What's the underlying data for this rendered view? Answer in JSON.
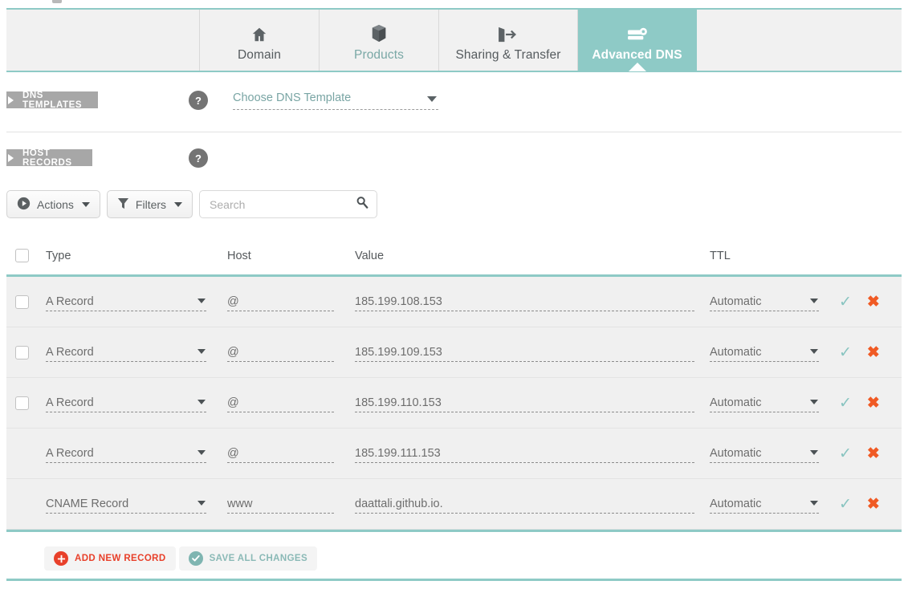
{
  "tabs": [
    {
      "id": "domain",
      "label": "Domain",
      "icon": "home-icon",
      "active": false
    },
    {
      "id": "products",
      "label": "Products",
      "icon": "box-icon",
      "active": false
    },
    {
      "id": "sharing",
      "label": "Sharing & Transfer",
      "icon": "transfer-icon",
      "active": false
    },
    {
      "id": "advanced",
      "label": "Advanced DNS",
      "icon": "server-icon",
      "active": true
    }
  ],
  "sections": {
    "dns_templates": {
      "label": "DNS TEMPLATES",
      "help": "?",
      "select_value": "Choose DNS Template"
    },
    "host_records": {
      "label": "HOST RECORDS",
      "help": "?"
    }
  },
  "toolbar": {
    "actions_label": "Actions",
    "filters_label": "Filters",
    "search_placeholder": "Search",
    "search_value": ""
  },
  "table": {
    "columns": [
      "Type",
      "Host",
      "Value",
      "TTL"
    ],
    "rows": [
      {
        "checkbox": true,
        "type": "A Record",
        "host": "@",
        "value": "185.199.108.153",
        "ttl": "Automatic"
      },
      {
        "checkbox": true,
        "type": "A Record",
        "host": "@",
        "value": "185.199.109.153",
        "ttl": "Automatic"
      },
      {
        "checkbox": true,
        "type": "A Record",
        "host": "@",
        "value": "185.199.110.153",
        "ttl": "Automatic"
      },
      {
        "checkbox": false,
        "type": "A Record",
        "host": "@",
        "value": "185.199.111.153",
        "ttl": "Automatic"
      },
      {
        "checkbox": false,
        "type": "CNAME Record",
        "host": "www",
        "value": "daattali.github.io.",
        "ttl": "Automatic"
      }
    ]
  },
  "footer": {
    "add_label": "ADD NEW RECORD",
    "save_label": "SAVE ALL CHANGES"
  },
  "colors": {
    "accent_teal": "#8ecac6",
    "danger_red": "#f05a24",
    "add_red": "#e8402a",
    "ribbon_gray": "#a7a7a7",
    "row_bg": "#f0f0f0"
  }
}
